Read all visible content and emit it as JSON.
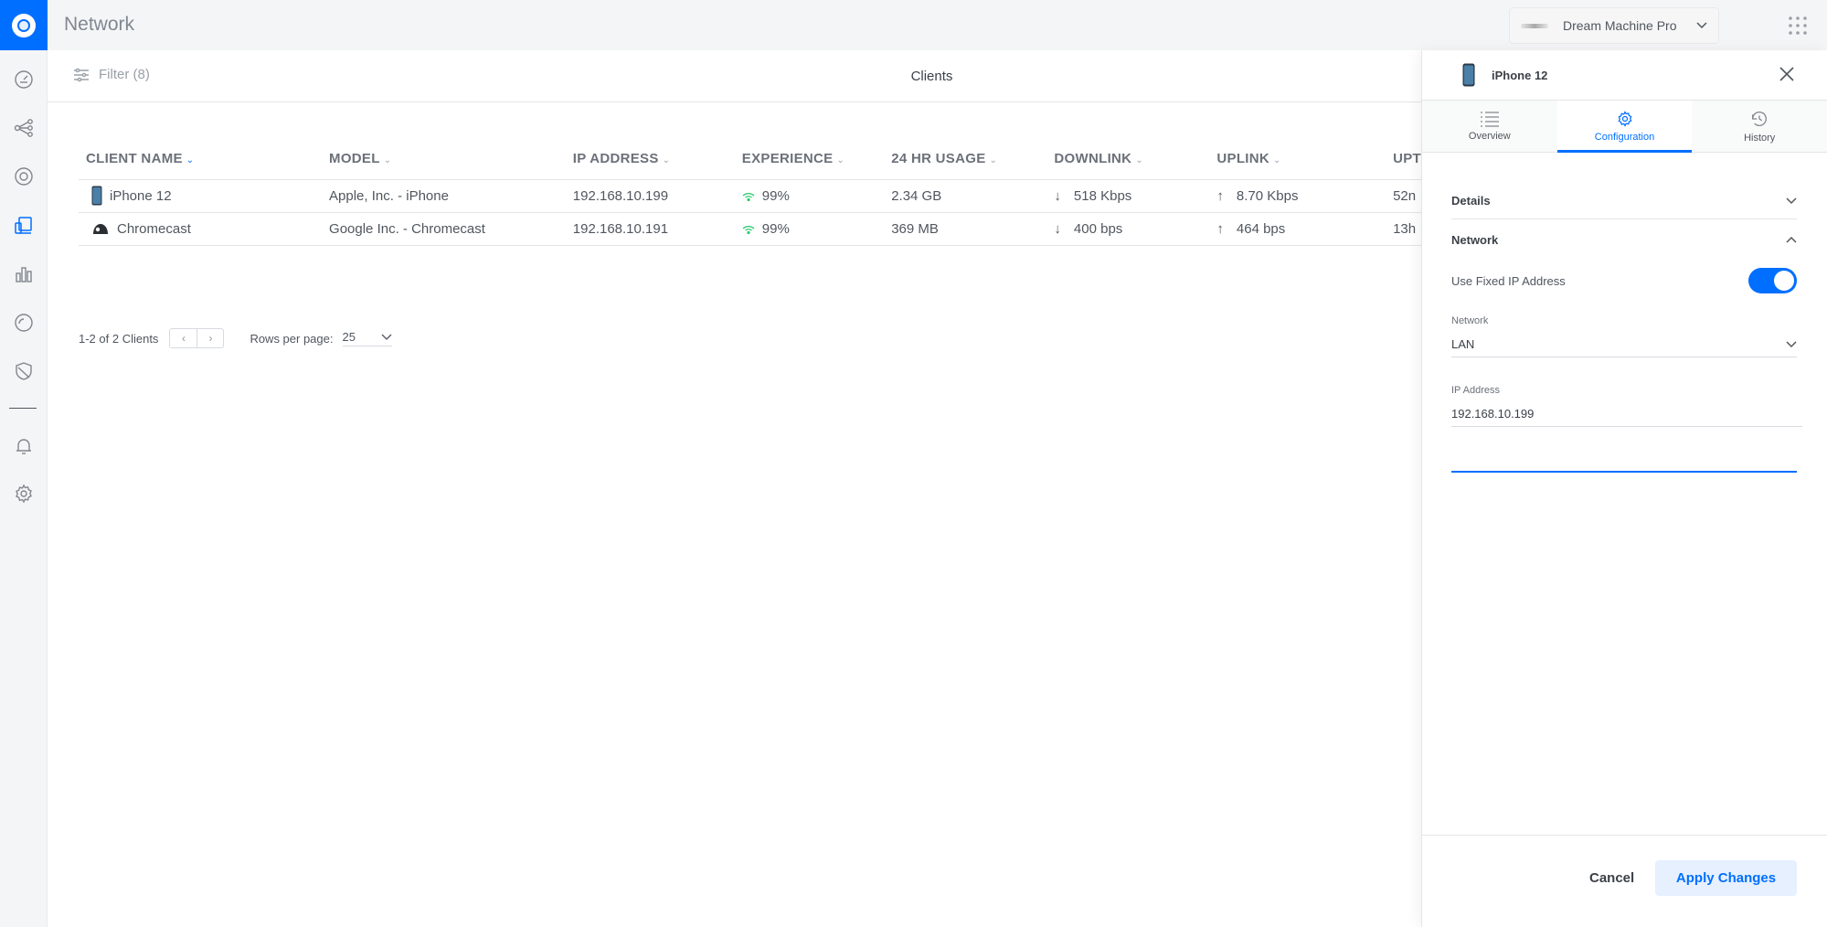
{
  "app": {
    "title": "Network"
  },
  "topbar": {
    "device_name": "Dream Machine Pro"
  },
  "toolbar": {
    "filter_label": "Filter (8)",
    "title": "Clients"
  },
  "table": {
    "columns": [
      "CLIENT NAME",
      "MODEL",
      "IP ADDRESS",
      "EXPERIENCE",
      "24 HR USAGE",
      "DOWNLINK",
      "UPLINK",
      "UPT"
    ],
    "rows": [
      {
        "name": "iPhone 12",
        "model": "Apple, Inc. - iPhone",
        "ip": "192.168.10.199",
        "experience": "99%",
        "usage": "2.34 GB",
        "downlink": "518 Kbps",
        "uplink": "8.70 Kbps",
        "uptime": "52n"
      },
      {
        "name": "Chromecast",
        "model": "Google Inc. - Chromecast",
        "ip": "192.168.10.191",
        "experience": "99%",
        "usage": "369 MB",
        "downlink": "400 bps",
        "uplink": "464 bps",
        "uptime": "13h"
      }
    ]
  },
  "pager": {
    "range": "1-2 of 2 Clients",
    "rows_per_page_label": "Rows per page:",
    "rows_per_page": "25"
  },
  "panel": {
    "title": "iPhone 12",
    "tabs": [
      "Overview",
      "Configuration",
      "History"
    ],
    "active_tab": "Configuration",
    "details_label": "Details",
    "network_label": "Network",
    "fixed_ip_label": "Use Fixed IP Address",
    "fixed_ip_enabled": true,
    "network_field_label": "Network",
    "network_value": "LAN",
    "ip_field_label": "IP Address",
    "ip_value": "192.168.10.199",
    "cancel_label": "Cancel",
    "apply_label": "Apply Changes"
  },
  "colors": {
    "accent": "#006fff",
    "downlink": "#1a73ff",
    "uplink": "#9b4dca",
    "experience": "#2ecc71"
  }
}
